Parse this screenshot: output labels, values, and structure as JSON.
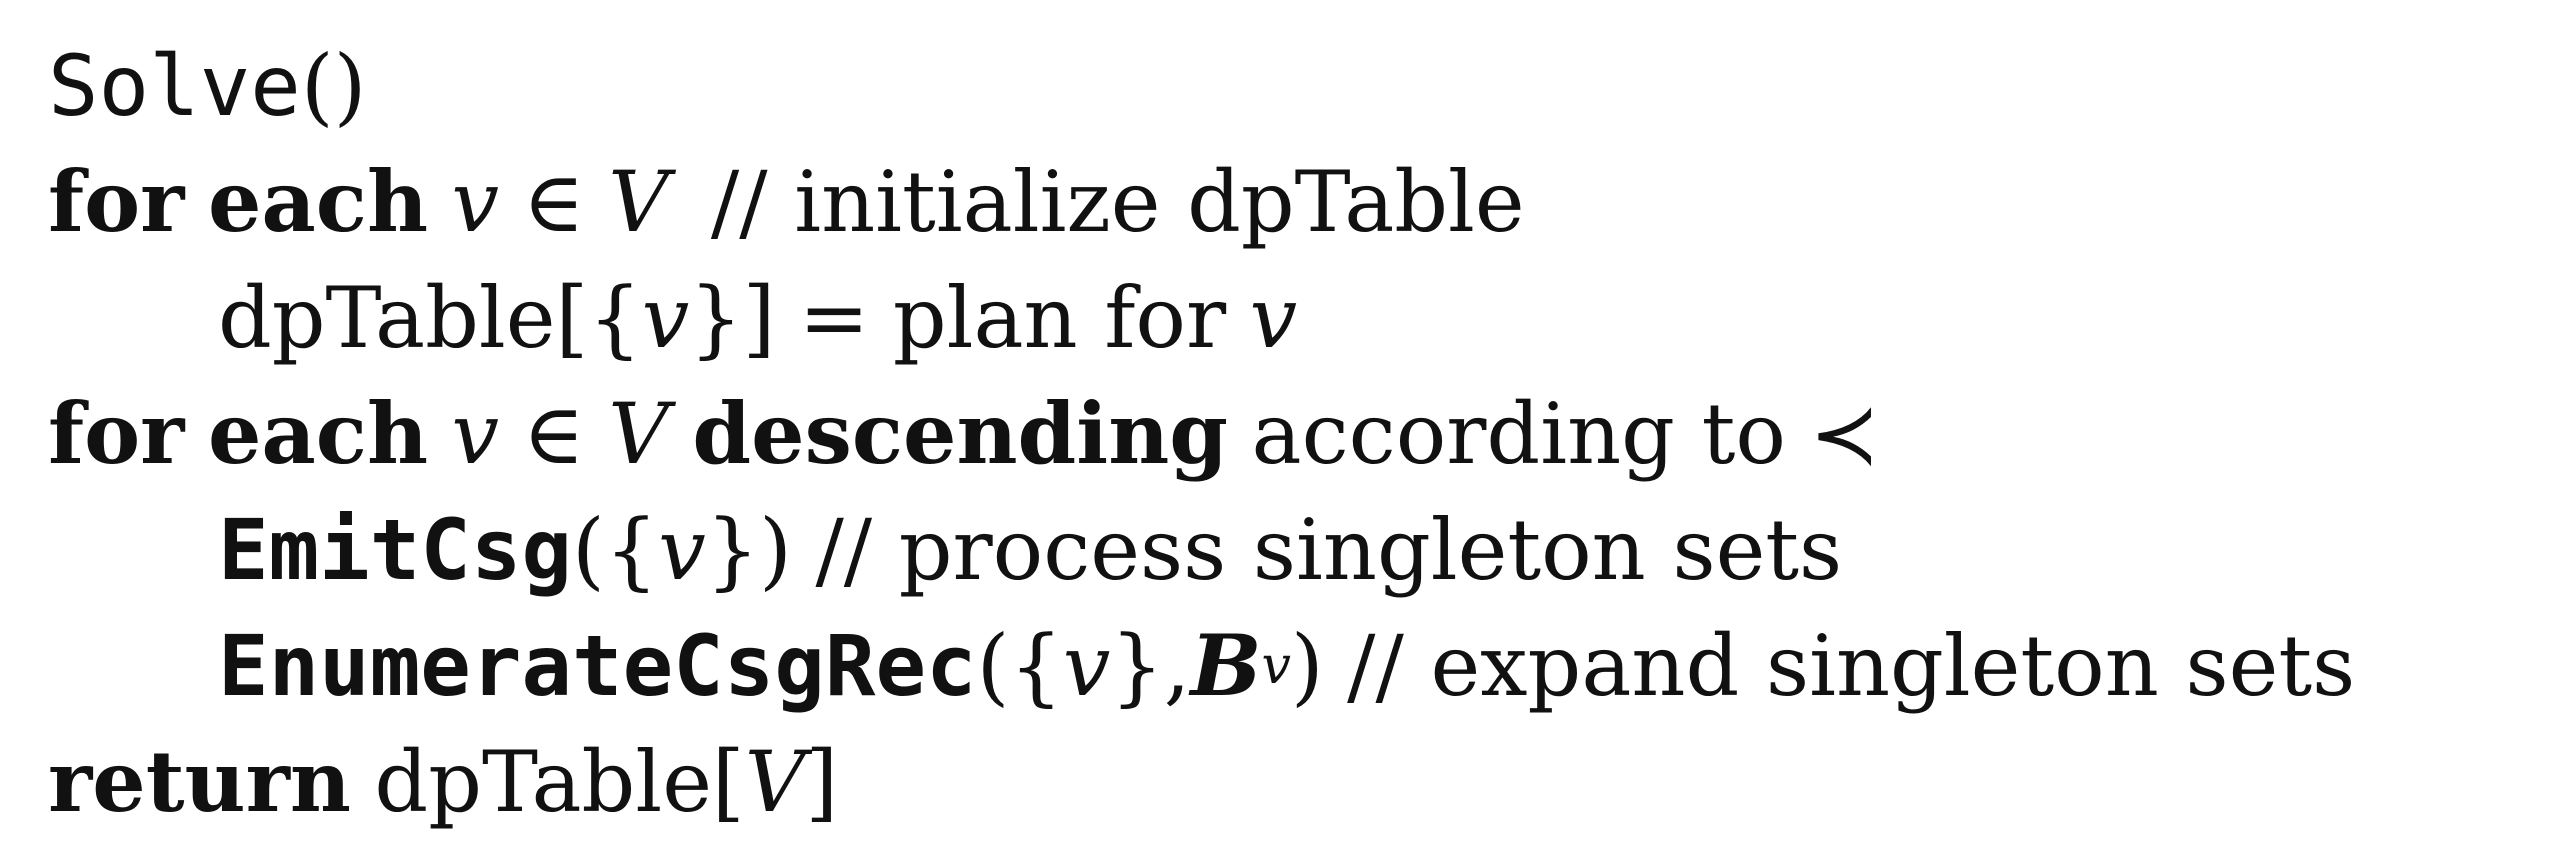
{
  "algorithm": {
    "line1": {
      "proc": "Solve",
      "parens": "()"
    },
    "line2": {
      "kw1": "for",
      "kw2": "each",
      "var": "v",
      "in": "∈",
      "set": "V",
      "comment": "// initialize dpTable"
    },
    "line3": {
      "table": "dpTable",
      "open": "[{",
      "var": "v",
      "close": "}]",
      "eq": "=",
      "text": "plan for",
      "var2": "v"
    },
    "line4": {
      "kw1": "for",
      "kw2": "each",
      "var": "v",
      "in": "∈",
      "set": "V",
      "kw3": "descending",
      "text": "according to",
      "prec": "≺"
    },
    "line5": {
      "proc": "EmitCsg",
      "open": "({",
      "var": "v",
      "close": "})",
      "comment": "// process singleton sets"
    },
    "line6": {
      "proc": "EnumerateCsgRec",
      "open": "({",
      "var": "v",
      "mid": "},",
      "calB": "B",
      "sub": "v",
      "close": ")",
      "comment": "// expand singleton sets"
    },
    "line7": {
      "kw": "return",
      "table": "dpTable",
      "open": "[",
      "set": "V",
      "close": "]"
    }
  }
}
